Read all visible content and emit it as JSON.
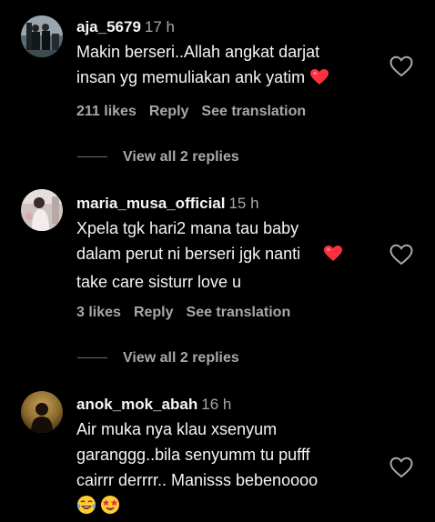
{
  "colors": {
    "background": "#000000",
    "text": "#f5f5f5",
    "secondary": "#a8a8a8",
    "heart": "#ff3040"
  },
  "comments": [
    {
      "username": "aja_5679",
      "time": "17 h",
      "lines": [
        "Makin berseri..Allah angkat darjat",
        "insan yg memuliakan ank yatim"
      ],
      "emoji": [
        "red-heart-emoji"
      ],
      "likes": "211 likes",
      "reply": "Reply",
      "translate": "See translation",
      "view_replies": "View all 2 replies"
    },
    {
      "username": "maria_musa_official",
      "time": "15 h",
      "lines": [
        "Xpela tgk hari2 mana tau baby",
        "dalam perut ni berseri jgk nanti",
        "take care sisturr love u"
      ],
      "emoji": [
        "red-heart-emoji"
      ],
      "likes": "3 likes",
      "reply": "Reply",
      "translate": "See translation",
      "view_replies": "View all 2 replies"
    },
    {
      "username": "anok_mok_abah",
      "time": "16 h",
      "lines": [
        "Air muka nya klau xsenyum",
        "garanggg..bila senyumm tu pufff",
        "cairrr derrrr.. Manisss bebenoooo"
      ],
      "emoji": [
        "tears-of-joy-emoji",
        "star-struck-emoji"
      ]
    }
  ]
}
